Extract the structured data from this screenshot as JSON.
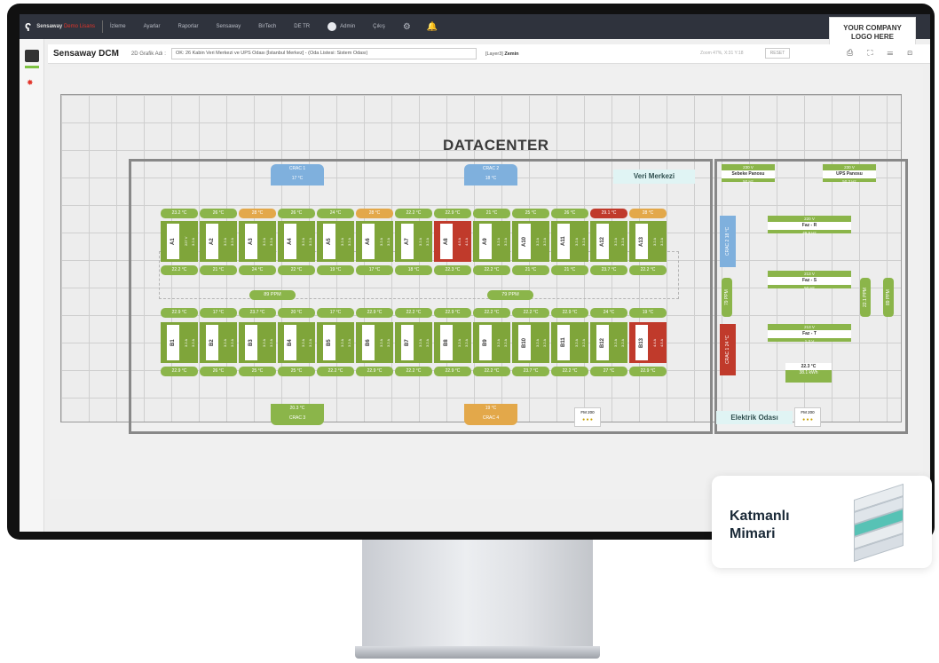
{
  "topbar": {
    "brand": "Sensaway",
    "brand_suffix": "Demo Lisans",
    "menu": [
      "İzleme",
      "Ayarlar",
      "Raporlar",
      "Sensaway",
      "BirTech",
      "DE TR"
    ],
    "user": "Admin",
    "logout": "Çıkış"
  },
  "company_logo": "YOUR COMPANY\nLOGO HERE",
  "subbar": {
    "app": "Sensaway DCM",
    "graph_label": "2D Grafik Adı :",
    "graph_value": "OK: 26 Kabin Veri Merkezi ve UPS Odası [İstanbul Merkez] - (Oda Listesi: Sistem Odası)",
    "layer": "[Layer3]",
    "layer_name": "Zemin",
    "zoom": "Zoom 47%, X:31 Y:18",
    "reset": "RESET"
  },
  "floor": {
    "title": "DATACENTER",
    "room1": "Veri Merkezi",
    "room2": "Elektrik Odası",
    "cracs": [
      {
        "name": "CRAC 1",
        "value": "17 °C",
        "color": "#7fb0dd"
      },
      {
        "name": "CRAC 2",
        "value": "18 °C",
        "color": "#7fb0dd"
      },
      {
        "name": "CRAC 3",
        "value": "20.3 °C",
        "color": "#8bb54a"
      },
      {
        "name": "CRAC 4",
        "value": "19 °C",
        "color": "#e3a84a"
      }
    ],
    "row_a_temps_top": [
      "23.2 °C",
      "26 °C",
      "28 °C",
      "26 °C",
      "24 °C",
      "28 °C",
      "22.2 °C",
      "22.9 °C",
      "21 °C",
      "25 °C",
      "26 °C",
      "29.1 °C",
      "28 °C"
    ],
    "row_a_temps_bottom": [
      "22.2 °C",
      "21 °C",
      "24 °C",
      "22 °C",
      "19 °C",
      "17 °C",
      "18 °C",
      "22.3 °C",
      "22.2 °C",
      "21 °C",
      "21 °C",
      "23.7 °C",
      "22.2 °C"
    ],
    "row_b_temps_top": [
      "22.9 °C",
      "17 °C",
      "23.7 °C",
      "20 °C",
      "17 °C",
      "22.9 °C",
      "22.2 °C",
      "22.9 °C",
      "22.2 °C",
      "22.2 °C",
      "22.9 °C",
      "24 °C",
      "19 °C"
    ],
    "row_b_temps_bottom": [
      "22.9 °C",
      "26 °C",
      "25 °C",
      "25 °C",
      "22.2 °C",
      "22.9 °C",
      "22.2 °C",
      "22.9 °C",
      "22.2 °C",
      "23.7 °C",
      "22.2 °C",
      "27 °C",
      "22.9 °C"
    ],
    "racks_a": [
      {
        "id": "A1",
        "i1": "227 V",
        "i2": "3.2 A",
        "hot": false
      },
      {
        "id": "A2",
        "i1": "3.2 A",
        "i2": "3.2 A",
        "hot": false
      },
      {
        "id": "A3",
        "i1": "3.2 A",
        "i2": "3.2 A",
        "hot": false
      },
      {
        "id": "A4",
        "i1": "3.2 A",
        "i2": "3.2 A",
        "hot": false
      },
      {
        "id": "A5",
        "i1": "3.2 A",
        "i2": "3.2 A",
        "hot": false
      },
      {
        "id": "A6",
        "i1": "3.2 A",
        "i2": "3.2 A",
        "hot": false
      },
      {
        "id": "A7",
        "i1": "3.2 A",
        "i2": "3.2 A",
        "hot": false
      },
      {
        "id": "A8",
        "i1": "4.5 A",
        "i2": "4.1 A",
        "hot": true
      },
      {
        "id": "A9",
        "i1": "3.2 A",
        "i2": "3.2 A",
        "hot": false
      },
      {
        "id": "A10",
        "i1": "3.2 A",
        "i2": "3.2 A",
        "hot": false
      },
      {
        "id": "A11",
        "i1": "3.2 A",
        "i2": "3.2 A",
        "hot": false
      },
      {
        "id": "A12",
        "i1": "3.2 A",
        "i2": "3.2 A",
        "hot": false
      },
      {
        "id": "A13",
        "i1": "3.2 A",
        "i2": "3.2 A",
        "hot": false
      }
    ],
    "racks_b": [
      {
        "id": "B1",
        "i1": "3.2 A",
        "i2": "3.2 A",
        "hot": false
      },
      {
        "id": "B2",
        "i1": "3.2 A",
        "i2": "3.2 A",
        "hot": false
      },
      {
        "id": "B3",
        "i1": "3.2 A",
        "i2": "3.2 A",
        "hot": false
      },
      {
        "id": "B4",
        "i1": "3.2 A",
        "i2": "3.2 A",
        "hot": false
      },
      {
        "id": "B5",
        "i1": "3.2 A",
        "i2": "3.2 A",
        "hot": false
      },
      {
        "id": "B6",
        "i1": "3.2 A",
        "i2": "3.2 A",
        "hot": false
      },
      {
        "id": "B7",
        "i1": "3.2 A",
        "i2": "3.2 A",
        "hot": false
      },
      {
        "id": "B8",
        "i1": "3.2 A",
        "i2": "3.2 A",
        "hot": false
      },
      {
        "id": "B9",
        "i1": "3.2 A",
        "i2": "3.2 A",
        "hot": false
      },
      {
        "id": "B10",
        "i1": "3.2 A",
        "i2": "3.2 A",
        "hot": false
      },
      {
        "id": "B11",
        "i1": "3.2 A",
        "i2": "3.2 A",
        "hot": false
      },
      {
        "id": "B12",
        "i1": "3.2 A",
        "i2": "3.2 A",
        "hot": false
      },
      {
        "id": "B13",
        "i1": "4.4 A",
        "i2": "4.5 A",
        "hot": true
      }
    ],
    "ppm_left": "89 PPM",
    "ppm_right": "79 PPM",
    "fm_label": "FM 200",
    "panels": [
      {
        "v": "230 V",
        "name": "Sebeke Panosu",
        "hz": "50 Hz"
      },
      {
        "v": "230 V",
        "name": "UPS Panosu",
        "hz": "50.3 Hz"
      }
    ],
    "phases": [
      {
        "v": "220 V",
        "name": "Faz - R",
        "hz": "49.9 Hz"
      },
      {
        "v": "213 V",
        "name": "Faz - S",
        "hz": "50 Hz"
      },
      {
        "v": "213 V",
        "name": "Faz - T",
        "hz": "1.3 V"
      }
    ],
    "elec_crac1": {
      "name": "CRAC 2",
      "value": "18 °C"
    },
    "elec_crac2": {
      "name": "CRAC 1",
      "value": "24 °C"
    },
    "elec_ppm1": "79 PPM",
    "elec_ppm2": "22.1 PPM",
    "elec_ppm3": "89 PPM",
    "elec_temp": "22.3 °C",
    "elec_kwh": "38.1 kWh"
  },
  "card": {
    "text": "Katmanlı Mimari"
  },
  "colors": {
    "green": "#8bb54a",
    "orange": "#e3a84a",
    "red": "#c03a2b",
    "blue": "#7fb0dd"
  }
}
